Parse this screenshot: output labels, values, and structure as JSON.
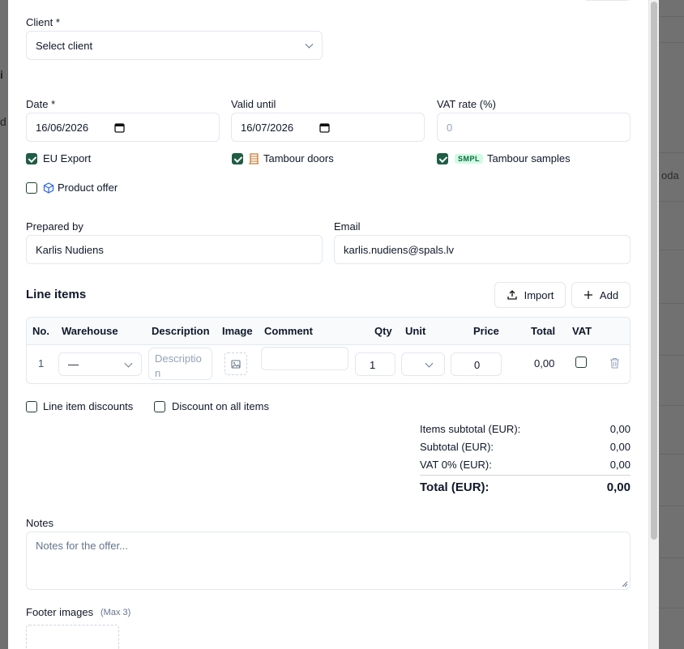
{
  "background": {
    "left_glyphs": [
      "i",
      "d"
    ],
    "right_header": "oda"
  },
  "client": {
    "label": "Client *",
    "placeholder": "Select client"
  },
  "date": {
    "label": "Date *",
    "value": "16/06/2026"
  },
  "valid_until": {
    "label": "Valid until",
    "value": "16/07/2026"
  },
  "vat_rate": {
    "label": "VAT rate (%)",
    "placeholder": "0"
  },
  "options": {
    "eu_export": {
      "label": "EU Export",
      "checked": true
    },
    "tambour_doors": {
      "label": "Tambour doors",
      "checked": true,
      "icon": "door-icon"
    },
    "tambour_samples": {
      "label": "Tambour samples",
      "checked": true,
      "badge": "SMPL"
    },
    "product_offer": {
      "label": "Product offer",
      "checked": false,
      "icon": "cube-icon"
    }
  },
  "prepared_by": {
    "label": "Prepared by",
    "value": "Karlis Nudiens"
  },
  "email": {
    "label": "Email",
    "value": "karlis.nudiens@spals.lv"
  },
  "line_items": {
    "title": "Line items",
    "import_label": "Import",
    "add_label": "Add",
    "columns": [
      "No.",
      "Warehouse",
      "Description",
      "Image",
      "Comment",
      "Qty",
      "Unit",
      "Price",
      "Total",
      "VAT"
    ],
    "rows": [
      {
        "no": "1",
        "warehouse": "—",
        "description_placeholder": "Descriptio n",
        "comment": "",
        "qty": "1",
        "unit": "",
        "price": "0",
        "total": "0,00",
        "vat": false
      }
    ]
  },
  "discounts": {
    "line_item_discounts": "Line item discounts",
    "discount_all": "Discount on all items"
  },
  "totals": {
    "items_subtotal_label": "Items subtotal (EUR):",
    "items_subtotal": "0,00",
    "subtotal_label": "Subtotal (EUR):",
    "subtotal": "0,00",
    "vat_label": "VAT 0% (EUR):",
    "vat": "0,00",
    "total_label": "Total (EUR):",
    "total": "0,00"
  },
  "notes": {
    "label": "Notes",
    "placeholder": "Notes for the offer..."
  },
  "footer_images": {
    "label": "Footer images",
    "hint": "(Max 3)"
  },
  "colors": {
    "accent": "#1f5d45",
    "border": "#e2e8f0",
    "muted": "#94a3b8",
    "badge_bg": "#d1fae5",
    "door_icon": "#c2762b",
    "cube_icon": "#2563eb"
  }
}
